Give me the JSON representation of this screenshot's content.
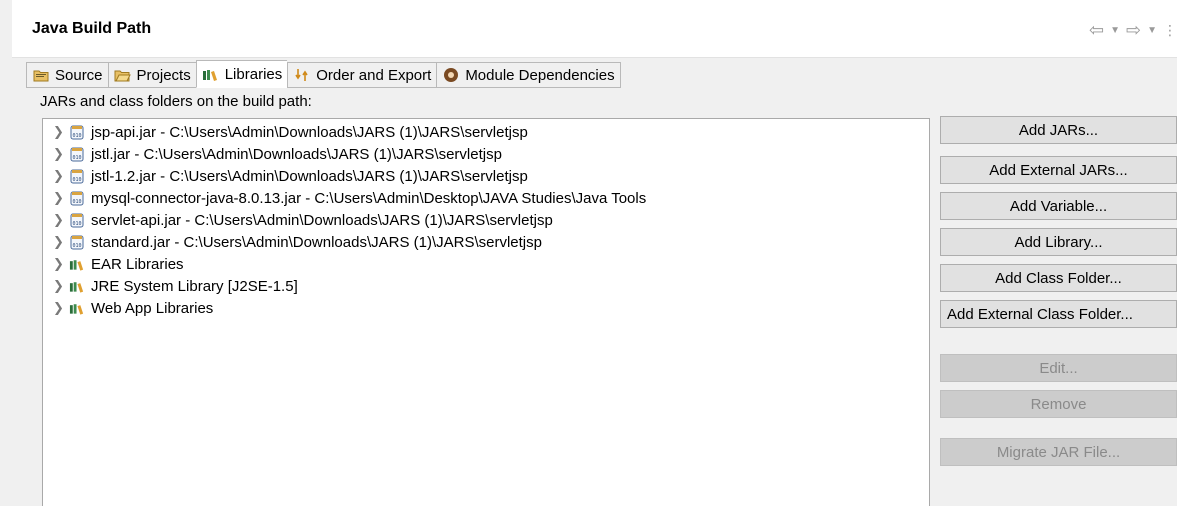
{
  "header": {
    "title": "Java Build Path"
  },
  "tabs": [
    {
      "label": "Source",
      "icon": "source-folder-icon"
    },
    {
      "label": "Projects",
      "icon": "projects-folder-icon"
    },
    {
      "label": "Libraries",
      "icon": "libraries-icon",
      "active": true
    },
    {
      "label": "Order and Export",
      "icon": "order-export-icon"
    },
    {
      "label": "Module Dependencies",
      "icon": "module-icon"
    }
  ],
  "section_label": "JARs and class folders on the build path:",
  "tree": [
    {
      "label": "jsp-api.jar - C:\\Users\\Admin\\Downloads\\JARS (1)\\JARS\\servletjsp",
      "icon": "jar-icon"
    },
    {
      "label": "jstl.jar - C:\\Users\\Admin\\Downloads\\JARS (1)\\JARS\\servletjsp",
      "icon": "jar-icon"
    },
    {
      "label": "jstl-1.2.jar - C:\\Users\\Admin\\Downloads\\JARS (1)\\JARS\\servletjsp",
      "icon": "jar-icon"
    },
    {
      "label": "mysql-connector-java-8.0.13.jar - C:\\Users\\Admin\\Desktop\\JAVA Studies\\Java Tools",
      "icon": "jar-icon"
    },
    {
      "label": "servlet-api.jar - C:\\Users\\Admin\\Downloads\\JARS (1)\\JARS\\servletjsp",
      "icon": "jar-icon"
    },
    {
      "label": "standard.jar - C:\\Users\\Admin\\Downloads\\JARS (1)\\JARS\\servletjsp",
      "icon": "jar-icon"
    },
    {
      "label": "EAR Libraries",
      "icon": "library-icon"
    },
    {
      "label": "JRE System Library [J2SE-1.5]",
      "icon": "library-icon"
    },
    {
      "label": "Web App Libraries",
      "icon": "library-icon"
    }
  ],
  "buttons": {
    "add_jars": "Add JARs...",
    "add_external_jars": "Add External JARs...",
    "add_variable": "Add Variable...",
    "add_library": "Add Library...",
    "add_class_folder": "Add Class Folder...",
    "add_external_class_folder": "Add External Class Folder...",
    "edit": "Edit...",
    "remove": "Remove",
    "migrate_jar": "Migrate JAR File..."
  },
  "colors": {
    "panel_bg": "#f0f0f0",
    "button_bg": "#e1e1e1",
    "disabled_button_bg": "#cccccc",
    "library_icon": "#2a6e3a",
    "jar_icon": "#d9a441"
  }
}
